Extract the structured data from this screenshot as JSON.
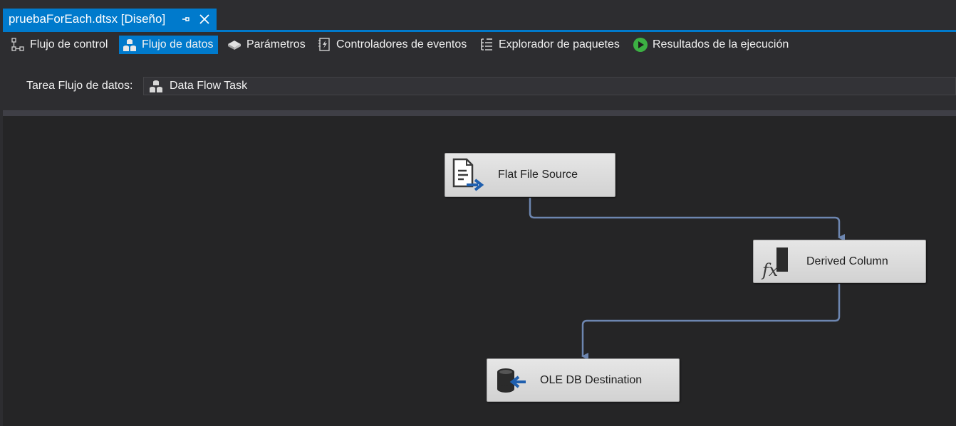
{
  "document_tab": {
    "title": "pruebaForEach.dtsx [Diseño]"
  },
  "designer_tabs": [
    {
      "label": "Flujo de control",
      "icon": "control-flow-icon",
      "active": false
    },
    {
      "label": "Flujo de datos",
      "icon": "data-flow-icon",
      "active": true
    },
    {
      "label": "Parámetros",
      "icon": "parameters-icon",
      "active": false
    },
    {
      "label": "Controladores de eventos",
      "icon": "event-handlers-icon",
      "active": false
    },
    {
      "label": "Explorador de paquetes",
      "icon": "package-explorer-icon",
      "active": false
    },
    {
      "label": "Resultados de la ejecución",
      "icon": "play-icon",
      "active": false
    }
  ],
  "task_selector": {
    "label": "Tarea Flujo de datos:",
    "value": "Data Flow Task"
  },
  "components": [
    {
      "label": "Flat File Source",
      "icon": "flat-file-source-icon"
    },
    {
      "label": "Derived Column",
      "icon": "derived-column-icon"
    },
    {
      "label": "OLE DB Destination",
      "icon": "ole-db-destination-icon"
    }
  ],
  "colors": {
    "accent": "#007acc",
    "connector": "#6d86b0",
    "surface": "#252526"
  }
}
